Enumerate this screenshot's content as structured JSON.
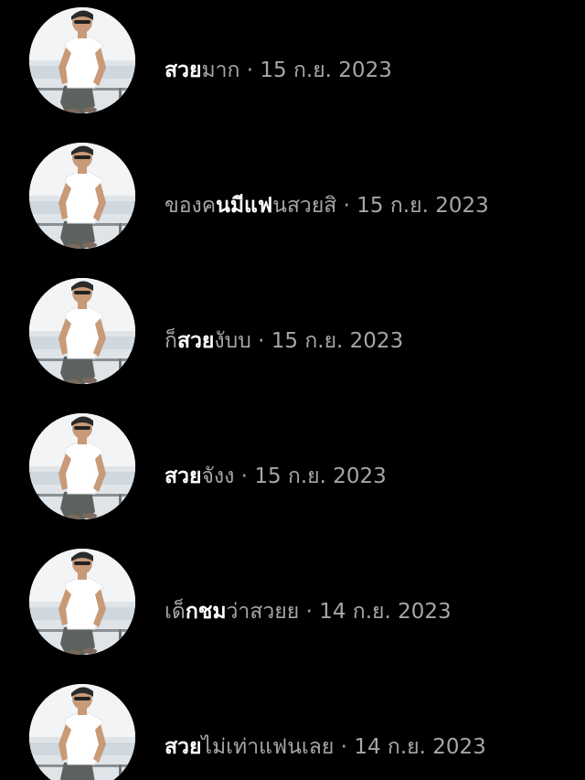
{
  "separator": " · ",
  "results": [
    {
      "pre": "",
      "highlight": "สวย",
      "post": "มาก",
      "date": "15 ก.ย. 2023"
    },
    {
      "pre": "ของค",
      "highlight": "นมีแฟ",
      "post": "นสวยสิ",
      "date": "15 ก.ย. 2023"
    },
    {
      "pre": "ก็",
      "highlight": "สวย",
      "post": "งับบ",
      "date": "15 ก.ย. 2023"
    },
    {
      "pre": "",
      "highlight": "สวย",
      "post": "จังง",
      "date": "15 ก.ย. 2023"
    },
    {
      "pre": "เด็",
      "highlight": "กชม",
      "post": "ว่าสวยย",
      "date": "14 ก.ย. 2023"
    },
    {
      "pre": "",
      "highlight": "สวย",
      "post": "ไม่เท่าแฟนเลย",
      "date": "14 ก.ย. 2023"
    }
  ]
}
